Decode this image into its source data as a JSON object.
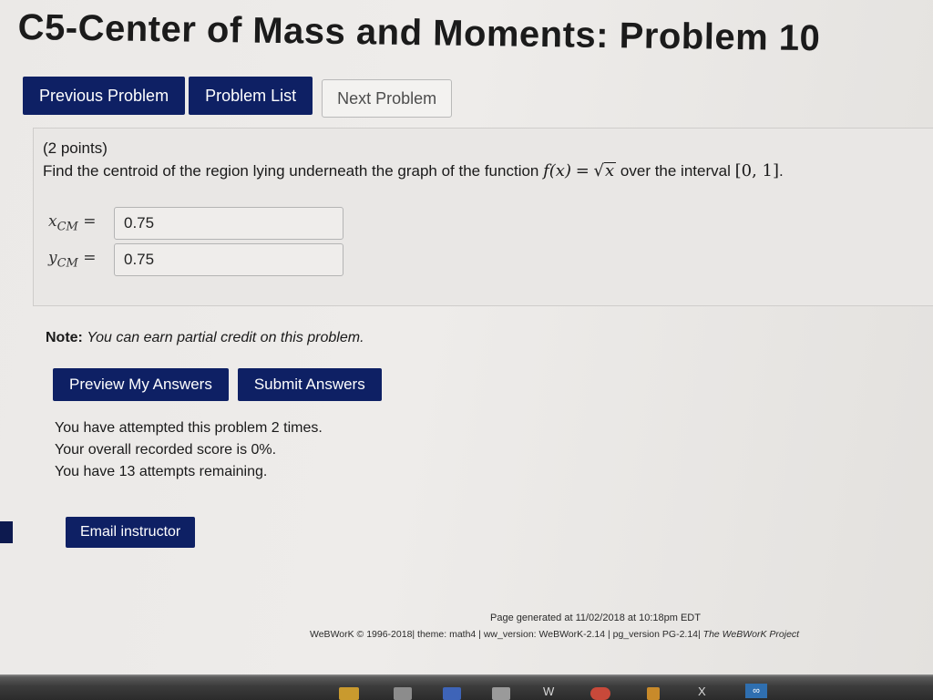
{
  "page": {
    "title": "C5-Center of Mass and Moments: Problem 10"
  },
  "nav": {
    "previous": "Previous Problem",
    "list": "Problem List",
    "next": "Next Problem"
  },
  "problem": {
    "points": "(2 points)",
    "question_prefix": "Find the centroid of the region lying underneath the graph of the function",
    "function_lhs": "f(x)",
    "equals": "=",
    "function_rhs_var": "x",
    "question_mid": "over the interval",
    "interval": "[0, 1]",
    "period": "."
  },
  "answers": [
    {
      "var": "x",
      "sub": "CM",
      "eq": "=",
      "value": "0.75"
    },
    {
      "var": "y",
      "sub": "CM",
      "eq": "=",
      "value": "0.75"
    }
  ],
  "note": {
    "label": "Note:",
    "text": "You can earn partial credit on this problem."
  },
  "actions": {
    "preview": "Preview My Answers",
    "submit": "Submit Answers"
  },
  "attempts": {
    "line1": "You have attempted this problem 2 times.",
    "line2": "Your overall recorded score is 0%.",
    "line3": "You have 13 attempts remaining."
  },
  "email": {
    "label": "Email instructor"
  },
  "footer": {
    "generated": "Page generated at 11/02/2018 at 10:18pm EDT",
    "copyright": "WeBWorK © 1996-2018| theme: math4 | ww_version: WeBWorK-2.14 | pg_version PG-2.14|",
    "project": "The WeBWorK Project"
  },
  "taskbar": {
    "item1": "W",
    "item2": "X",
    "item3": "∞"
  },
  "colors": {
    "brand_button": "#0e2064",
    "background": "#e6e4e2"
  }
}
